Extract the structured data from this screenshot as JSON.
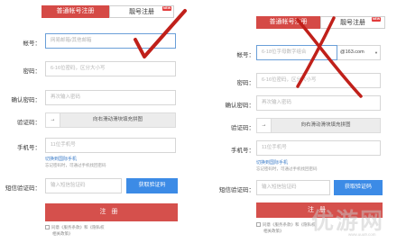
{
  "left": {
    "tab_active": "普通帐号注册",
    "tab_inactive": "靓号注册",
    "tab_badge": "NEW",
    "account_label": "帐号：",
    "account_placeholder": "网易邮箱/其他邮箱",
    "password_label": "密码：",
    "password_placeholder": "6-16位密码，区分大小写",
    "confirm_label": "确认密码：",
    "confirm_placeholder": "再次输入密码",
    "captcha_label": "验证码：",
    "slider_arrow": "→",
    "slider_text": "向右滑动滑块填充拼图",
    "phone_label": "手机号：",
    "phone_placeholder": "11位手机号",
    "switch_link": "切换到国际手机",
    "phone_note": "忘记密码时，可通过手机找回密码",
    "sms_label": "短信验证码：",
    "sms_placeholder": "输入短信验证码",
    "sms_button": "获取验证码",
    "register_button": "注册",
    "agree_line1": "同意《服务条款》和《隐私权",
    "agree_line2": "相关政策》"
  },
  "right": {
    "tab_active": "普通帐号注册",
    "tab_inactive": "靓号注册",
    "tab_badge": "NEW",
    "account_label": "帐号：",
    "account_placeholder": "6-18位字母数字组合",
    "domain_value": "@163.com",
    "password_label": "密码：",
    "password_placeholder": "6-16位密码，区分大小写",
    "confirm_label": "确认密码：",
    "confirm_placeholder": "再次输入密码",
    "captcha_label": "验证码：",
    "slider_arrow": "→",
    "slider_text": "向右滑动滑块填充拼图",
    "phone_label": "手机号：",
    "phone_placeholder": "11位手机号",
    "switch_link": "切换到国际手机",
    "phone_note": "忘记密码时，可通过手机找回密码",
    "sms_label": "短信验证码：",
    "sms_placeholder": "输入短信验证码",
    "sms_button": "获取验证码",
    "register_button": "注册",
    "agree_line1": "同意《服务条款》和《隐私权",
    "agree_line2": "相关政策》"
  },
  "watermark": {
    "text": "优游网",
    "sub": "www.uuu9.com"
  },
  "colors": {
    "accent_red": "#d54a46",
    "button_blue": "#3c8be6",
    "mark_red": "#c0201a"
  },
  "icons": {
    "left_mark": "checkmark-icon",
    "right_mark": "cross-mark-icon",
    "captcha_handle": "arrow-right-icon"
  }
}
